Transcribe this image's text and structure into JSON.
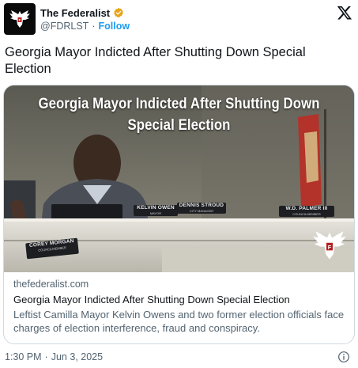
{
  "account": {
    "name": "The Federalist",
    "handle": "@FDRLST",
    "separator": "·",
    "follow_label": "Follow",
    "avatar_icon": "federalist-eagle-logo",
    "verified_color": "#e8a317"
  },
  "platform_icon": "x-logo-icon",
  "tweet": {
    "text": "Georgia Mayor Indicted After Shutting Down Special Election"
  },
  "card": {
    "image": {
      "overlay_title": "Georgia Mayor Indicted After Shutting Down Special Election",
      "nameplates": [
        {
          "name": "KELVIN OWEN",
          "title": "MAYOR"
        },
        {
          "name": "DENNIS STROUD",
          "title": "CITY MANAGER"
        },
        {
          "name": "W.D. PALMER III",
          "title": "COUNCILMEMBER"
        },
        {
          "name": "COREY MORGAN",
          "title": "COUNCILMEMBER"
        }
      ],
      "watermark_icon": "federalist-eagle-logo"
    },
    "domain": "thefederalist.com",
    "title": "Georgia Mayor Indicted After Shutting Down Special Election",
    "description": "Leftist Camilla Mayor Kelvin Owens and two former election officials face charges of election interference, fraud and conspiracy."
  },
  "footer": {
    "time": "1:30 PM",
    "separator": "·",
    "date": "Jun 3, 2025",
    "info_icon": "info-icon"
  },
  "colors": {
    "link": "#1d9bf0",
    "secondary_text": "#536471",
    "border": "#cfd9de"
  }
}
